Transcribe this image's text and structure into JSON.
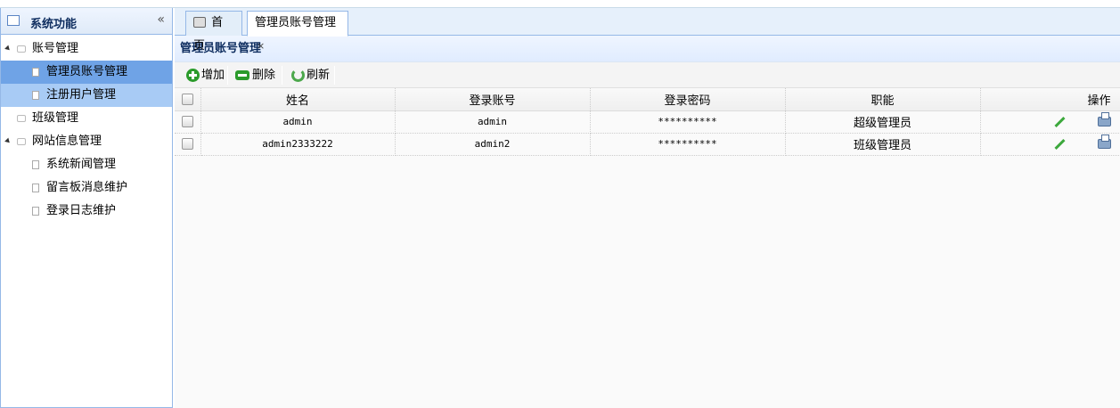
{
  "sidebar": {
    "title": "系统功能",
    "collapse_glyph": "«",
    "nodes": [
      {
        "label": "账号管理"
      },
      {
        "label": "管理员账号管理"
      },
      {
        "label": "注册用户管理"
      },
      {
        "label": "班级管理"
      },
      {
        "label": "网站信息管理"
      },
      {
        "label": "系统新闻管理"
      },
      {
        "label": "留言板消息维护"
      },
      {
        "label": "登录日志维护"
      }
    ]
  },
  "tabs": {
    "home": "首页",
    "active": "管理员账号管理",
    "close_glyph": "×"
  },
  "panel": {
    "title": "管理员账号管理"
  },
  "toolbar": {
    "add": "增加",
    "delete": "删除",
    "refresh": "刷新"
  },
  "table": {
    "headers": [
      "姓名",
      "登录账号",
      "登录密码",
      "职能",
      "操作"
    ],
    "rows": [
      {
        "name": "admin",
        "account": "admin",
        "password": "**********",
        "role": "超级管理员"
      },
      {
        "name": "admin2333222",
        "account": "admin2",
        "password": "**********",
        "role": "班级管理员"
      }
    ]
  },
  "colors": {
    "selected_node": "#6fa3e6",
    "hover_node": "#a8cbf5",
    "border": "#95b8e7",
    "accent_green": "#2b9b2b"
  },
  "icons": [
    "grid-icon",
    "collapse-icon",
    "home-icon",
    "close-icon",
    "add-icon",
    "delete-icon",
    "refresh-icon",
    "edit-icon",
    "print-icon",
    "file-icon",
    "folder-icon"
  ]
}
